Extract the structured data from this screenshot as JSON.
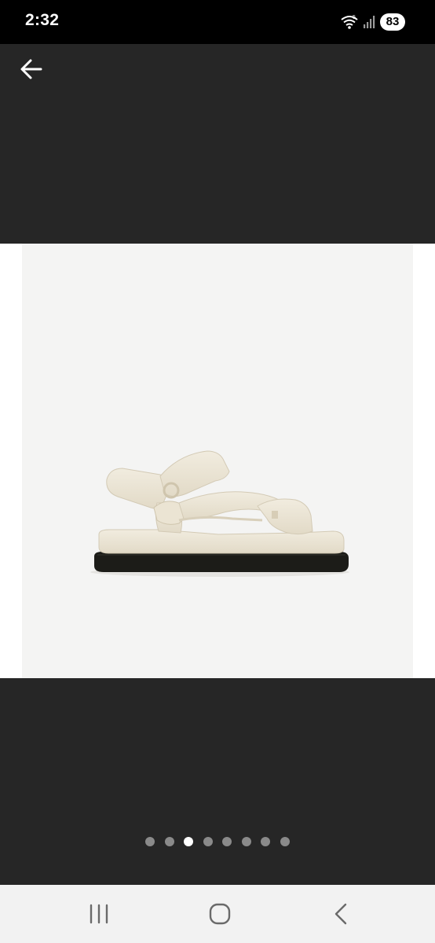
{
  "status_bar": {
    "time": "2:32",
    "battery": "83",
    "wifi_icon": "wifi-icon",
    "signal_icon": "signal-icon"
  },
  "toolbar": {
    "back_icon": "arrow-left-icon"
  },
  "gallery": {
    "image_description_icon": "sandal-photo",
    "page_count": 8,
    "current_page": 3
  },
  "nav_bar": {
    "recents_icon": "recents-icon",
    "home_icon": "home-icon",
    "back_icon": "back-chevron-icon"
  },
  "colors": {
    "background": "#262626",
    "status_bar": "#000000",
    "image_bg": "#f4f4f3",
    "dot_active": "#ffffff",
    "dot_inactive": "#8a8a8a",
    "nav_bar": "#f2f2f2"
  }
}
